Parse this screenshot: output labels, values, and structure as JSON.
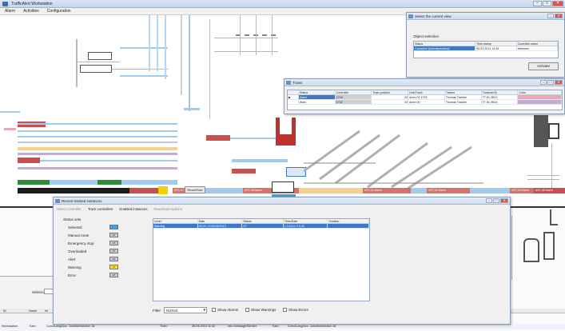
{
  "window": {
    "title": "TrafficAlert Workstation"
  },
  "menu": [
    "Alarm",
    "Activities",
    "Configuration"
  ],
  "selection_dialog": {
    "title": "Select the current view",
    "group_label": "Object selection",
    "columns": [
      "Status",
      "Time stamp",
      "Controller name"
    ],
    "row": [
      "Cancelled (Interdependent)",
      "06.03.2013 13:45",
      "Hetmann"
    ],
    "ok_label": "Activate"
  },
  "train_dialog": {
    "title": "Trains",
    "columns": [
      "",
      "Status",
      "Controller",
      "Train position",
      "Line/Track",
      "Trainer",
      "Tracknet ID",
      "Color"
    ],
    "rows": [
      [
        "▶",
        "Alarm",
        "1718",
        "22",
        "Amm 01 1733",
        "Thomas Trainee",
        "TT 61-2B13",
        ""
      ],
      [
        "",
        "Warn",
        "1732",
        "22",
        "Amm 00",
        "Thomas Trainee",
        "TT 61-2B14",
        ""
      ]
    ]
  },
  "event_dialog": {
    "title": "Recent tracked instances",
    "toolbar": [
      "Select controller",
      "Track controllers",
      "Enabled instances",
      "Reset/Sort options"
    ],
    "small_btn": "Reset/Sort",
    "status_heading": "Status sets",
    "legend": [
      {
        "label": "Selected",
        "color": "#3ea0e8",
        "code": ""
      },
      {
        "label": "Manual route",
        "color": "#c8c8c8",
        "code": "VT"
      },
      {
        "label": "Emergency stop",
        "color": "#c8c8c8",
        "code": "VT"
      },
      {
        "label": "Overloaded",
        "color": "#c8c8c8",
        "code": "VT"
      },
      {
        "label": "Alert",
        "color": "#c8c8c8",
        "code": "VT"
      },
      {
        "label": "Warning",
        "color": "#f2e03a",
        "code": "VT"
      },
      {
        "label": "Error",
        "color": "#c8c8c8",
        "code": "VT"
      }
    ],
    "table_columns": [
      "Level",
      "Date",
      "Status",
      "Time/Date",
      "Solution"
    ],
    "table_row": [
      "Warning",
      "05.03. 10:54:04/2013",
      "VT",
      "1.3.15.4 / 13.45",
      ""
    ],
    "filter_label": "Filter",
    "filter_value": "Normal",
    "check_labels": [
      "Show Alarms",
      "Show Warnings",
      "Show Errors"
    ]
  },
  "bottom_panel": {
    "search_label": "Selection",
    "columns": [
      "ID",
      "Name",
      "Nr"
    ],
    "row": [
      "Workstation",
      "Tram",
      "Conv/Long/Acc. Junction/section 16",
      "Tram",
      "26.04.2013 11:42",
      "Info message/Sender",
      "Tram",
      "Conv/Long/Acc. Junction/section 16"
    ]
  },
  "track_labels": [
    "ATC-27 Alarm",
    "ATC-30 Alarm",
    "ATC-31 Alarm",
    "ATC-32 Alarm",
    "ATC-33 Alarm",
    "ATC-35 Alarm",
    "ATC-40 Alarm",
    "ATC-41 Alarm"
  ],
  "colors": {
    "blue": "#9ecbef",
    "pink": "#e8a9b2",
    "red": "#c94f4f",
    "orange": "#f7cf8e",
    "purple": "#caa6d9",
    "green": "#2e8b3a",
    "yellow": "#f5d000"
  }
}
